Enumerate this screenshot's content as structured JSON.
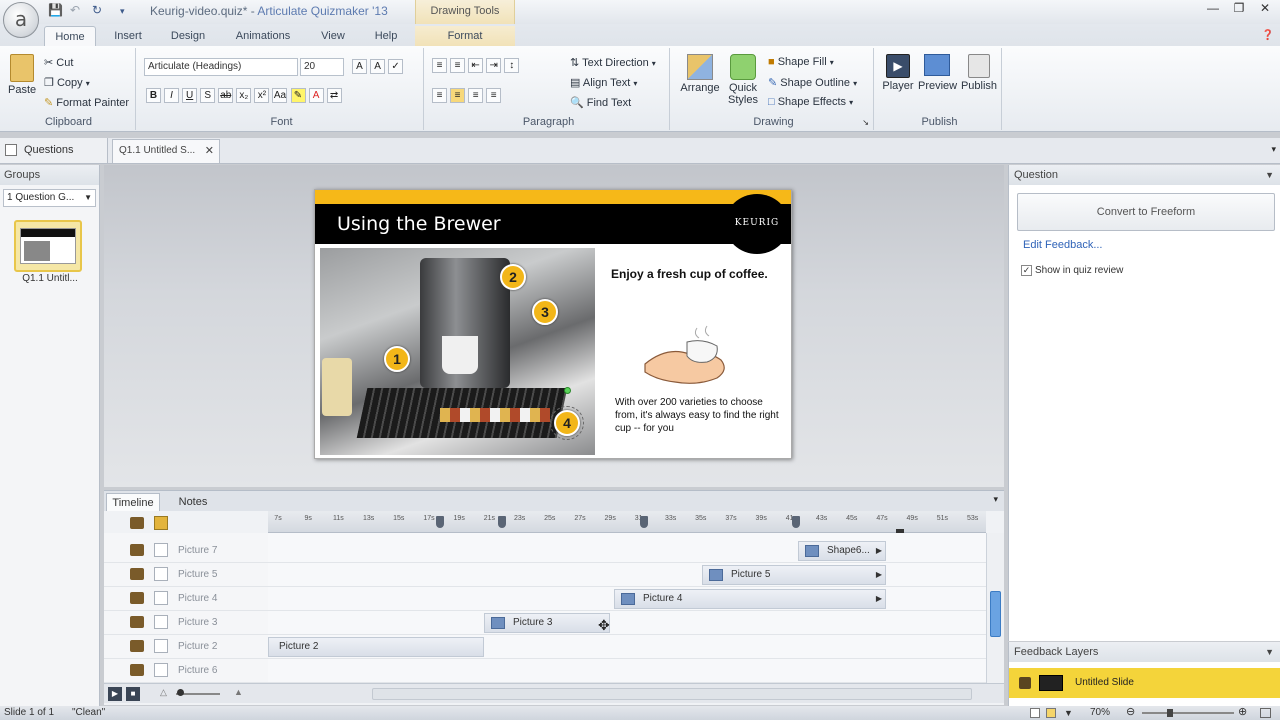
{
  "app": {
    "logo": "a",
    "title_doc": "Keurig-video.quiz*",
    "title_sep": " - ",
    "title_app": "Articulate Quizmaker '13",
    "context_tab": "Drawing Tools"
  },
  "tabs": [
    "Home",
    "Insert",
    "Design",
    "Animations",
    "View",
    "Help",
    "Format"
  ],
  "ribbon": {
    "clipboard": {
      "paste": "Paste",
      "cut": "Cut",
      "copy": "Copy",
      "format_painter": "Format Painter",
      "label": "Clipboard"
    },
    "font": {
      "face": "Articulate (Headings)",
      "size": "20",
      "label": "Font"
    },
    "paragraph": {
      "text_direction": "Text Direction",
      "align_text": "Align Text",
      "find_text": "Find Text",
      "label": "Paragraph"
    },
    "drawing": {
      "arrange": "Arrange",
      "quick_styles": "Quick Styles",
      "shape_fill": "Shape Fill",
      "shape_outline": "Shape Outline",
      "shape_effects": "Shape Effects",
      "label": "Drawing"
    },
    "publish": {
      "player": "Player",
      "preview": "Preview",
      "publish": "Publish",
      "label": "Publish"
    }
  },
  "docbar": {
    "questions": "Questions",
    "slide_tab": "Q1.1 Untitled S..."
  },
  "left": {
    "header": "Groups",
    "group_select": "1 Question G...",
    "thumb_label": "Q1.1 Untitl..."
  },
  "slide": {
    "title": "Using the Brewer",
    "brand": "KEURIG",
    "heading": "Enjoy a fresh cup of coffee.",
    "body": "With over 200 varieties to choose from, it's always easy to find the right cup -- for you",
    "callouts": [
      "1",
      "2",
      "3",
      "4"
    ]
  },
  "timeline": {
    "tabs": [
      "Timeline",
      "Notes"
    ],
    "ticks": [
      "7s",
      "9s",
      "11s",
      "13s",
      "15s",
      "17s",
      "19s",
      "21s",
      "23s",
      "25s",
      "27s",
      "29s",
      "31s",
      "33s",
      "35s",
      "37s",
      "39s",
      "41s",
      "43s",
      "45s",
      "47s",
      "49s",
      "51s",
      "53s"
    ],
    "rows": [
      {
        "name": "Picture 7",
        "bar": "Shape6..."
      },
      {
        "name": "Picture 5",
        "bar": "Picture 5"
      },
      {
        "name": "Picture 4",
        "bar": "Picture 4"
      },
      {
        "name": "Picture 3",
        "bar": "Picture 3"
      },
      {
        "name": "Picture 2",
        "bar": "Picture 2"
      },
      {
        "name": "Picture 6",
        "bar": ""
      }
    ]
  },
  "right": {
    "question_header": "Question",
    "convert": "Convert to Freeform",
    "edit_feedback": "Edit Feedback...",
    "show_review": "Show in quiz review",
    "show_review_checked": true,
    "feedback_header": "Feedback Layers",
    "feedback_row": "Untitled Slide"
  },
  "status": {
    "slide": "Slide 1 of 1",
    "theme": "\"Clean\"",
    "zoom": "70%"
  }
}
